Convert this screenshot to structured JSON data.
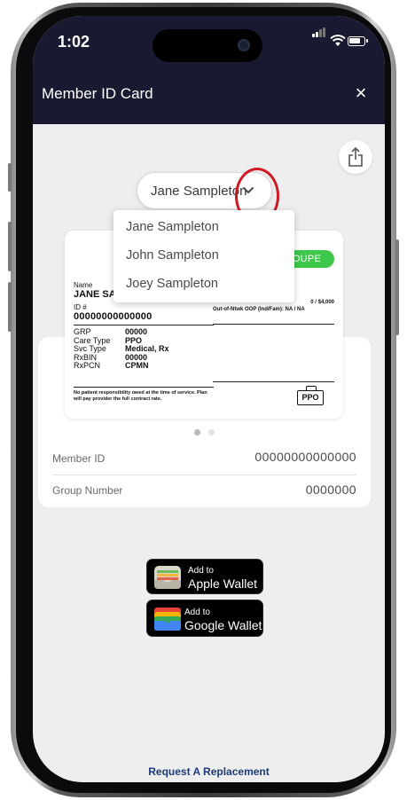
{
  "status_bar": {
    "time": "1:02"
  },
  "header": {
    "title": "Member ID Card",
    "close_label": "×"
  },
  "member_selector": {
    "selected": "Jane Sampleton",
    "options": [
      "Jane Sampleton",
      "John Sampleton",
      "Joey Sampleton"
    ]
  },
  "id_card": {
    "badge_text": "OUPE",
    "name_label": "Name",
    "name_value": "JANE SA",
    "id_label": "ID #",
    "id_value": "00000000000000",
    "rows": [
      {
        "key": "GRP",
        "value": "00000"
      },
      {
        "key": "Care Type",
        "value": "PPO"
      },
      {
        "key": "Svc Type",
        "value": "Medical, Rx"
      },
      {
        "key": "RxBIN",
        "value": "00000"
      },
      {
        "key": "RxPCN",
        "value": "CPMN"
      }
    ],
    "right_line_1": "0 / $4,000",
    "right_line_2": "Out-of-Ntwk OOP (Ind/Fam): NA / NA",
    "footnote": "No patient responsibility owed at the time of service. Plan will pay provider the full contract rate.",
    "plan_badge": "PPO"
  },
  "carousel": {
    "pages": 2,
    "active_page": 1
  },
  "info": {
    "member_id_label": "Member ID",
    "member_id_value": "00000000000000",
    "group_number_label": "Group Number",
    "group_number_value": "0000000"
  },
  "wallet": {
    "apple_small": "Add to",
    "apple_big": "Apple Wallet",
    "google_small": "Add to",
    "google_big": "Google Wallet"
  },
  "footer": {
    "request_replacement": "Request A Replacement"
  },
  "colors": {
    "header_bg": "#191932",
    "highlight_circle": "#cf1a24",
    "badge_green": "#3ec84a",
    "link_blue": "#1d3a7a"
  }
}
